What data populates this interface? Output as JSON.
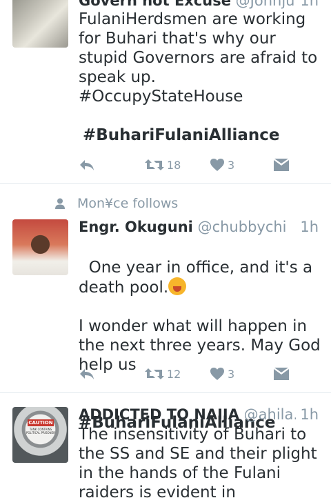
{
  "tweets": [
    {
      "name": "Govern not Excuse",
      "handle": "@Johnju...",
      "time": "1h",
      "text": "FulaniHerdsmen are working for Buhari that's why our stupid Governors are afraid to speak up.\n#OccupyStateHouse",
      "hashtag": "#BuhariFulaniAlliance",
      "retweets": "18",
      "likes": "3"
    },
    {
      "context": "Mon¥ce follows",
      "name": "Engr. Okuguni",
      "handle": "@chubbychi",
      "time": "1h",
      "text_line1": "One year in office, and it's a death pool.",
      "text_rest": "I wonder what will happen in the next three years. May God help us",
      "hashtag": "#BuhariFulaniAlliance",
      "retweets": "12",
      "likes": "3"
    },
    {
      "name": "ADDICTED TO NAIJA",
      "handle": "@ahila...",
      "time": "1h",
      "avatar_sign": "CAUTION",
      "avatar_small": "TANK CONTAINS POLITICAL PRISONER",
      "text": "The insensitivity of Buhari to the SS and SE and their plight in the hands of the Fulani raiders is evident in"
    }
  ],
  "icons": {
    "reply": "reply-icon",
    "retweet": "retweet-icon",
    "like": "heart-icon",
    "dm": "direct-message-icon",
    "follows": "person-icon"
  },
  "colors": {
    "text": "#292f33",
    "muted": "#8899a6",
    "divider": "#e1e8ed"
  }
}
